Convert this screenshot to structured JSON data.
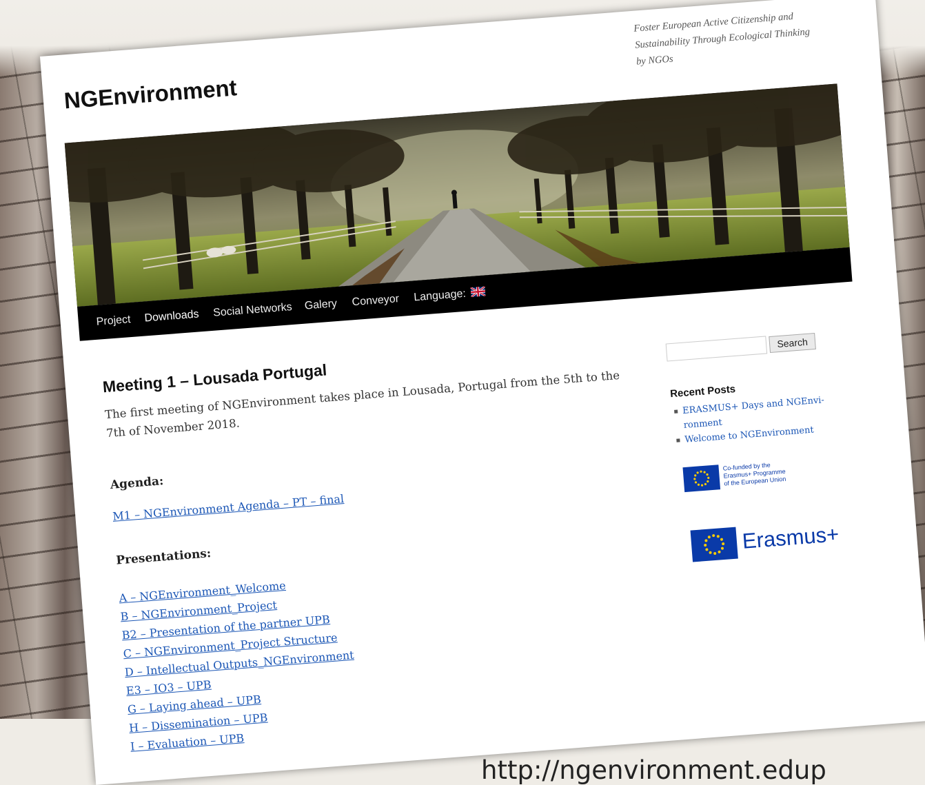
{
  "site": {
    "title": "NGEnvironment",
    "tagline": "Foster European Active Citizenship and Sustainability Through Ecological Thinking by NGOs"
  },
  "nav": {
    "items": [
      "Project",
      "Downloads",
      "Social Networks",
      "Galery",
      "Conveyor"
    ],
    "active": "Downloads",
    "language_label": "Language:",
    "language_flag": "uk-flag-icon"
  },
  "post": {
    "title": "Meeting 1 – Lousada Portugal",
    "intro": "The first meeting of NGEnvironment takes place in Lousada, Portugal from the 5th to the 7th of November 2018.",
    "agenda_heading": "Agenda:",
    "agenda_link": "M1 – NGEnvironment Agenda – PT – final",
    "presentations_heading": "Presentations:",
    "presentations": [
      "A – NGEnvironment_Welcome",
      "B – NGEnvironment_Project",
      "B2 – Presentation of the partner UPB",
      "C – NGEnvironment_Project Structure",
      "D – Intellectual Outputs_NGEnvironment",
      "E3 – IO3 – UPB",
      "G – Laying ahead – UPB",
      "H – Dissemination – UPB",
      "I – Evaluation – UPB"
    ]
  },
  "sidebar": {
    "search_value": "",
    "search_button": "Search",
    "recent_title": "Recent Posts",
    "recent_posts": [
      "ERASMUS+ Days and NGEnvi-ronment",
      "Welcome to NGEnvironment"
    ],
    "cofunded_text": [
      "Co-funded by the",
      "Erasmus+ Programme",
      "of the European Union"
    ],
    "erasmus_label": "Erasmus+"
  },
  "caption": {
    "url_text": "http://ngenvironment.edup"
  },
  "colors": {
    "link": "#1b56b5",
    "nav_bg": "#000000",
    "eu_blue": "#0a3aa8",
    "eu_star": "#ffcc00"
  }
}
